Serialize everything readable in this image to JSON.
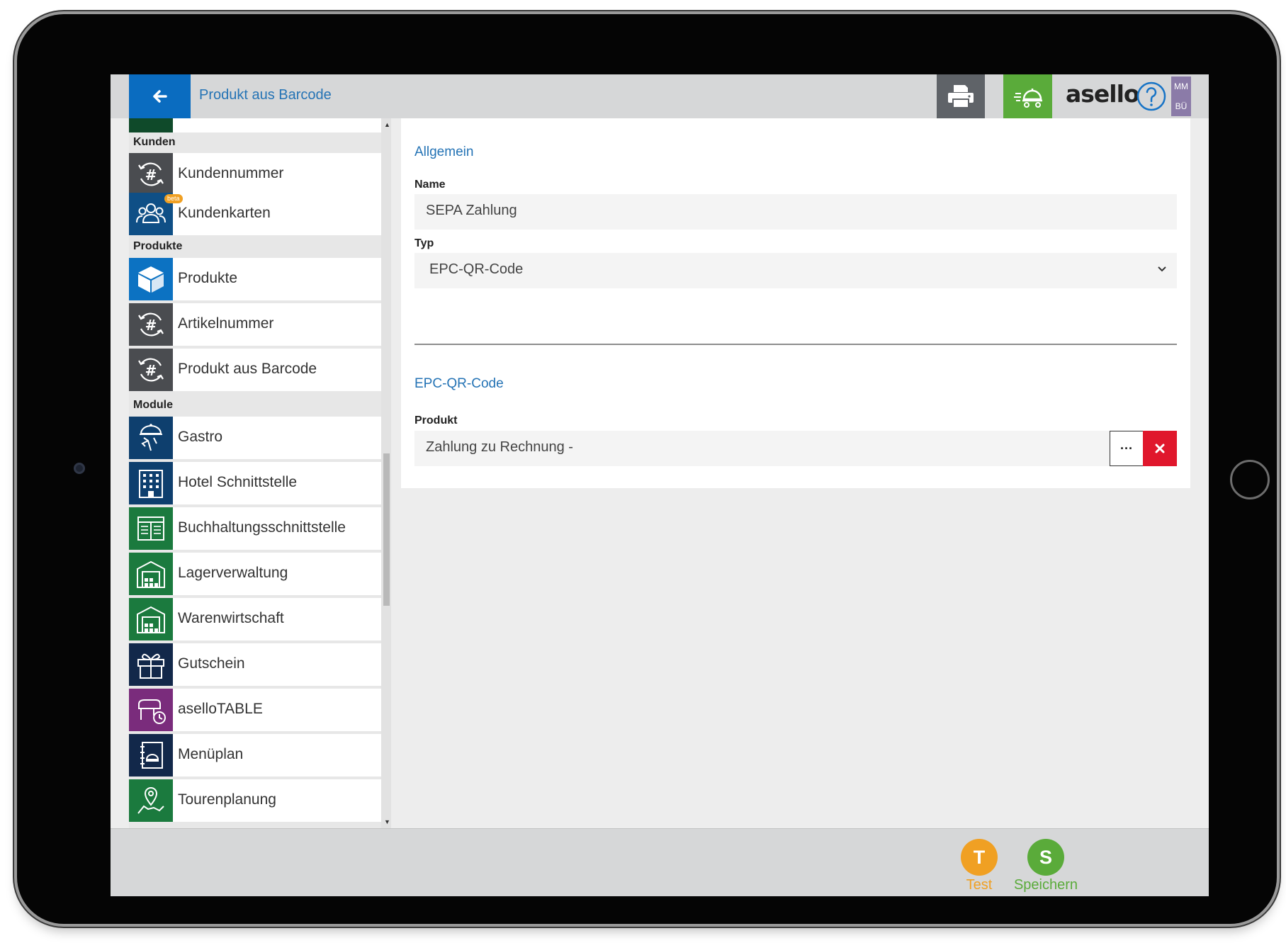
{
  "header": {
    "title": "Produkt aus Barcode",
    "logo": "asello",
    "user_initials_top": "MM",
    "user_initials_bottom": "BÜ",
    "icons": {
      "back": "arrow-left-icon",
      "print": "printer-icon",
      "delivery": "delivery-cloche-icon",
      "help": "question-circle-icon"
    }
  },
  "sidebar": {
    "sections": {
      "kunden": "Kunden",
      "produkte": "Produkte",
      "module": "Module"
    },
    "items": [
      {
        "label": "Kundennummer",
        "icon": "hash-refresh-icon",
        "color": "#4a4c50"
      },
      {
        "label": "Kundenkarten",
        "icon": "customers-icon",
        "color": "#0f4f86",
        "badge": "beta"
      },
      {
        "label": "Produkte",
        "icon": "cube-icon",
        "color": "#0c72c2"
      },
      {
        "label": "Artikelnummer",
        "icon": "hash-refresh-icon",
        "color": "#4a4c50"
      },
      {
        "label": "Produkt aus Barcode",
        "icon": "hash-refresh-icon",
        "color": "#4a4c50"
      },
      {
        "label": "Gastro",
        "icon": "waiter-cloche-icon",
        "color": "#0e3f6e"
      },
      {
        "label": "Hotel Schnittstelle",
        "icon": "hotel-building-icon",
        "color": "#0e3f6e"
      },
      {
        "label": "Buchhaltungsschnittstelle",
        "icon": "ledger-icon",
        "color": "#1b7a3e"
      },
      {
        "label": "Lagerverwaltung",
        "icon": "warehouse-icon",
        "color": "#1b7a3e"
      },
      {
        "label": "Warenwirtschaft",
        "icon": "warehouse-icon",
        "color": "#1b7a3e"
      },
      {
        "label": "Gutschein",
        "icon": "gift-icon",
        "color": "#12284a"
      },
      {
        "label": "aselloTABLE",
        "icon": "table-clock-icon",
        "color": "#7a2c7c"
      },
      {
        "label": "Menüplan",
        "icon": "menu-book-icon",
        "color": "#12284a"
      },
      {
        "label": "Tourenplanung",
        "icon": "map-route-icon",
        "color": "#1b7a3e"
      }
    ]
  },
  "form": {
    "section_general": "Allgemein",
    "name_label": "Name",
    "name_value": "SEPA Zahlung",
    "type_label": "Typ",
    "type_value": "EPC-QR-Code",
    "section_epc": "EPC-QR-Code",
    "product_label": "Produkt",
    "product_value": "Zahlung zu Rechnung -",
    "more_label": "···"
  },
  "actions": {
    "test": {
      "letter": "T",
      "label": "Test",
      "color": "#f0a023"
    },
    "save": {
      "letter": "S",
      "label": "Speichern",
      "color": "#5aab3a"
    }
  }
}
